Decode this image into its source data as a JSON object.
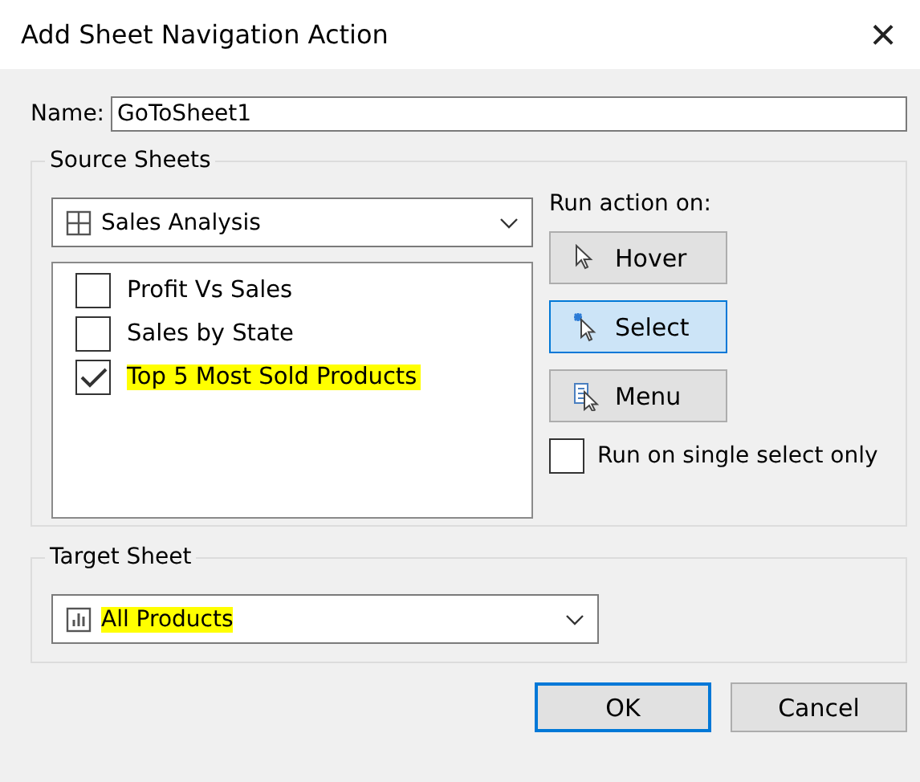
{
  "window": {
    "title": "Add Sheet Navigation Action",
    "close": "×"
  },
  "name": {
    "label": "Name:",
    "value": "GoToSheet1"
  },
  "source_sheets": {
    "title": "Source Sheets",
    "dashboard": {
      "value": "Sales Analysis"
    },
    "sheets": [
      {
        "label": "Profit Vs Sales",
        "checked": false,
        "highlighted": false
      },
      {
        "label": "Sales by State",
        "checked": false,
        "highlighted": false
      },
      {
        "label": "Top 5 Most Sold Products",
        "checked": true,
        "highlighted": true
      }
    ],
    "run_action_on": {
      "label": "Run action on:",
      "options": [
        {
          "kind": "hover",
          "label": "Hover",
          "selected": false
        },
        {
          "kind": "select",
          "label": "Select",
          "selected": true
        },
        {
          "kind": "menu",
          "label": "Menu",
          "selected": false
        }
      ]
    },
    "single_select": {
      "label": "Run on single select only",
      "checked": false
    }
  },
  "target_sheet": {
    "title": "Target Sheet",
    "value": "All Products",
    "highlighted": true
  },
  "buttons": [
    {
      "label": "OK",
      "default": true
    },
    {
      "label": "Cancel",
      "default": false
    }
  ]
}
